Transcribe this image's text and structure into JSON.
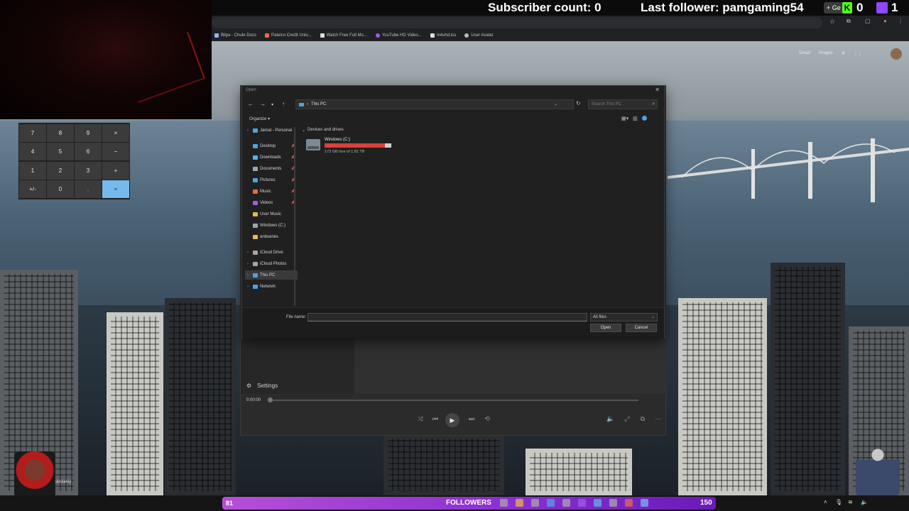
{
  "overlay": {
    "subscriber_count": "Subscriber count: 0",
    "last_follower": "Last follower: pamgaming54",
    "kick_count": "0",
    "twitch_count": "1",
    "badge_label": "+ Ge"
  },
  "browser": {
    "bookmarks": [
      "Bilpa - Chute Docs",
      "Patelco Credit Unio...",
      "Watch Free Full Mo...",
      "YouTube HD Video...",
      "m4uhd.icu",
      "User Avatar"
    ],
    "google_links": [
      "Gmail",
      "Images"
    ]
  },
  "calculator": {
    "rows": [
      [
        "7",
        "8",
        "9",
        "×"
      ],
      [
        "4",
        "5",
        "6",
        "−"
      ],
      [
        "1",
        "2",
        "3",
        "+"
      ],
      [
        "+/-",
        "0",
        ".",
        "="
      ]
    ]
  },
  "dialog": {
    "title": "Open",
    "address": "This PC",
    "search_placeholder": "Search This PC",
    "organize_label": "Organize ▾",
    "nav_items": [
      {
        "label": "Jamal - Personal",
        "icon": "cloud-icon",
        "color": "#4ca3e6",
        "expand": true,
        "pin": false
      },
      {
        "label": "Desktop",
        "icon": "desktop-folder-icon",
        "color": "#4ca3e6",
        "expand": false,
        "pin": true
      },
      {
        "label": "Downloads",
        "icon": "download-icon",
        "color": "#5fb0e8",
        "expand": false,
        "pin": true
      },
      {
        "label": "Documents",
        "icon": "documents-icon",
        "color": "#9aa8b4",
        "expand": false,
        "pin": true
      },
      {
        "label": "Pictures",
        "icon": "pictures-icon",
        "color": "#4ca3e6",
        "expand": false,
        "pin": true
      },
      {
        "label": "Music",
        "icon": "music-icon",
        "color": "#e06c4f",
        "expand": false,
        "pin": true
      },
      {
        "label": "Videos",
        "icon": "videos-icon",
        "color": "#9b5de5",
        "expand": false,
        "pin": true
      },
      {
        "label": "User Music",
        "icon": "folder-icon",
        "color": "#e8b84a",
        "expand": false,
        "pin": false
      },
      {
        "label": "Windows (C:)",
        "icon": "drive-icon",
        "color": "#9aa8b4",
        "expand": false,
        "pin": false
      },
      {
        "label": "enbseries",
        "icon": "folder-icon",
        "color": "#e8b84a",
        "expand": false,
        "pin": false
      },
      {
        "label": "iCloud Drive",
        "icon": "icloud-drive-icon",
        "color": "#9aa8b4",
        "expand": true,
        "pin": false
      },
      {
        "label": "iCloud Photos",
        "icon": "icloud-photos-icon",
        "color": "#9aa8b4",
        "expand": true,
        "pin": false
      },
      {
        "label": "This PC",
        "icon": "computer-icon",
        "color": "#4ca3e6",
        "expand": true,
        "pin": false,
        "selected": true
      },
      {
        "label": "Network",
        "icon": "network-icon",
        "color": "#4ca3e6",
        "expand": true,
        "pin": false
      }
    ],
    "section_title": "Devices and drives",
    "drive": {
      "name": "Windows (C:)",
      "free_text": "173 GB free of 1.81 TB",
      "used_fraction": 0.907
    },
    "file_name_label": "File name:",
    "file_name_value": "",
    "file_type": "All files",
    "open_label": "Open",
    "cancel_label": "Cancel"
  },
  "player": {
    "settings_label": "Settings",
    "time": "0:00:00"
  },
  "stream": {
    "username": "sbotaniy",
    "followers_label": "FOLLOWERS",
    "followers_left": "81",
    "followers_goal": "150"
  },
  "colors": {
    "accent": "#4ca3e6",
    "drive_used": "#d9413a",
    "followers_bar": "#8a2ed1",
    "calc_equals": "#76b9ed"
  }
}
